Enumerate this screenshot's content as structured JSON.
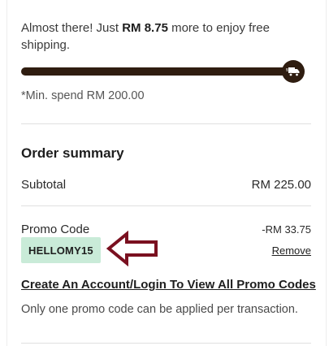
{
  "shipping": {
    "prefix": "Almost there! Just ",
    "amount": "RM 8.75",
    "suffix": " more to enjoy free shipping.",
    "progress_fraction": 0.956,
    "min_spend": "*Min. spend RM 200.00",
    "icon": "delivery-truck-icon"
  },
  "summary": {
    "title": "Order summary",
    "subtotal_label": "Subtotal",
    "subtotal_value": "RM 225.00",
    "promo_label": "Promo Code",
    "promo_discount": "-RM 33.75",
    "promo_code": "HELLOMY15",
    "remove_label": "Remove",
    "create_account_link": "Create An Account/Login To View All Promo Codes",
    "promo_note": "Only one promo code can be applied per transaction."
  },
  "colors": {
    "progress": "#2f1d10",
    "promo_chip": "#c9ebd8",
    "arrow": "#7a1020"
  }
}
